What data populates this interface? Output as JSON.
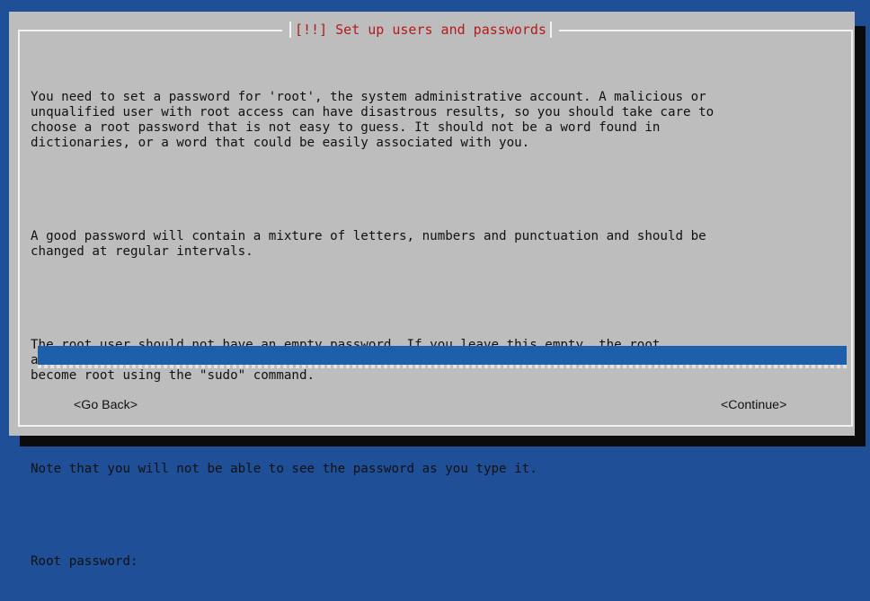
{
  "dialog": {
    "title": "[!!] Set up users and passwords",
    "paragraphs": [
      "You need to set a password for 'root', the system administrative account. A malicious or\nunqualified user with root access can have disastrous results, so you should take care to\nchoose a root password that is not easy to guess. It should not be a word found in\ndictionaries, or a word that could be easily associated with you.",
      "A good password will contain a mixture of letters, numbers and punctuation and should be\nchanged at regular intervals.",
      "The root user should not have an empty password. If you leave this empty, the root\naccount will be disabled and the system's initial user account will be given the power to\nbecome root using the \"sudo\" command.",
      "Note that you will not be able to see the password as you type it."
    ],
    "field_label": "Root password:",
    "field_value": "",
    "buttons": {
      "back": "<Go Back>",
      "continue": "<Continue>"
    }
  },
  "colors": {
    "background": "#1f4f97",
    "dialog": "#bdbdbd",
    "title": "#b31a1a",
    "input": "#1d5fab",
    "border": "#f2f2f2",
    "shadow": "#0b0b0b"
  }
}
